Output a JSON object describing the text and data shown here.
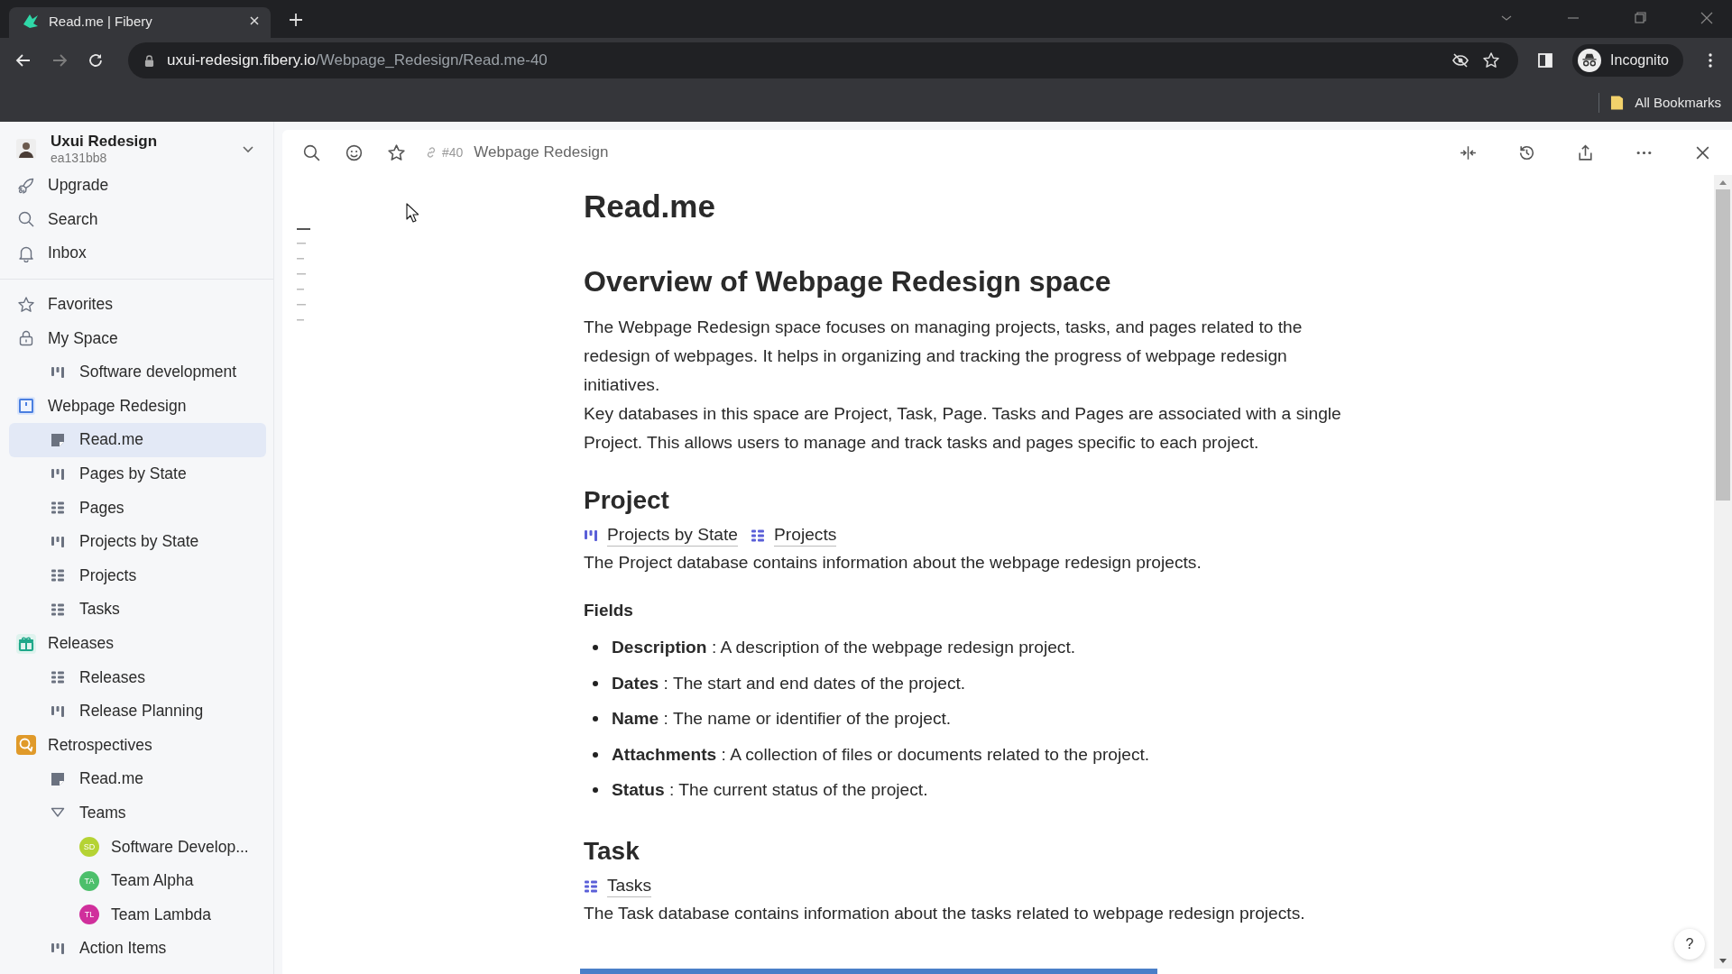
{
  "browser": {
    "tab": {
      "title": "Read.me | Fibery",
      "selected": true
    },
    "url": {
      "host": "uxui-redesign.fibery.io",
      "path": "/Webpage_Redesign/Read.me-40"
    },
    "profile": "Incognito",
    "bookmarks": "All Bookmarks"
  },
  "sidebar": {
    "workspace": {
      "name": "Uxui Redesign",
      "id": "ea131bb8"
    },
    "nav": [
      {
        "label": "Upgrade"
      },
      {
        "label": "Search"
      },
      {
        "label": "Inbox"
      }
    ],
    "tree": [
      {
        "label": "Favorites",
        "kind": "favorites",
        "selected": false
      },
      {
        "label": "My Space",
        "kind": "private",
        "selected": false,
        "children": [
          {
            "label": "Software development",
            "kind": "board",
            "selected": false
          }
        ]
      },
      {
        "label": "Webpage Redesign",
        "kind": "space",
        "color": "#4a7fe0",
        "selected": false,
        "children": [
          {
            "label": "Read.me",
            "kind": "doc",
            "selected": true
          },
          {
            "label": "Pages by State",
            "kind": "board",
            "selected": false
          },
          {
            "label": "Pages",
            "kind": "table",
            "selected": false
          },
          {
            "label": "Projects by State",
            "kind": "board",
            "selected": false
          },
          {
            "label": "Projects",
            "kind": "table",
            "selected": false
          },
          {
            "label": "Tasks",
            "kind": "table",
            "selected": false
          }
        ]
      },
      {
        "label": "Releases",
        "kind": "release-space",
        "color": "#1fa88a",
        "selected": false,
        "children": [
          {
            "label": "Releases",
            "kind": "table",
            "selected": false
          },
          {
            "label": "Release Planning",
            "kind": "board",
            "selected": false
          }
        ]
      },
      {
        "label": "Retrospectives",
        "kind": "retro-space",
        "color": "#e09a2a",
        "selected": false,
        "children": [
          {
            "label": "Read.me",
            "kind": "doc",
            "selected": false
          },
          {
            "label": "Teams",
            "kind": "folder",
            "selected": false,
            "expanded": true,
            "children": [
              {
                "label": "Software Develop...",
                "kind": "team",
                "initials": "SD",
                "color": "#b5d334",
                "selected": false
              },
              {
                "label": "Team Alpha",
                "kind": "team",
                "initials": "TA",
                "color": "#4cbf6b",
                "selected": false
              },
              {
                "label": "Team Lambda",
                "kind": "team",
                "initials": "TL",
                "color": "#d02f9c",
                "selected": false
              }
            ]
          },
          {
            "label": "Action Items",
            "kind": "board",
            "selected": false
          }
        ]
      }
    ]
  },
  "header": {
    "number": "#40",
    "breadcrumb": "Webpage Redesign"
  },
  "document": {
    "blocks": [
      {
        "kind": "title",
        "text": "Read.me"
      },
      {
        "kind": "h2",
        "text": "Overview of Webpage Redesign space"
      },
      {
        "kind": "p",
        "text": "The Webpage Redesign space focuses on managing projects, tasks, and pages related to the redesign of webpages. It helps in organizing and tracking the progress of webpage redesign initiatives."
      },
      {
        "kind": "p",
        "text": "Key databases in this space are Project, Task, Page. Tasks and Pages are associated with a single Project. This allows users to manage and track tasks and pages specific to each project."
      },
      {
        "kind": "h3",
        "text": "Project"
      },
      {
        "kind": "links",
        "links": [
          {
            "label": "Projects by State",
            "kind": "board"
          },
          {
            "label": "Projects",
            "kind": "table"
          }
        ]
      },
      {
        "kind": "p",
        "text": "The Project database contains information about the webpage redesign projects."
      },
      {
        "kind": "label",
        "text": "Fields"
      },
      {
        "kind": "bullets",
        "items": [
          "**Description** : A description of the webpage redesign project.",
          "**Dates** : The start and end dates of the project.",
          "**Name** : The name or identifier of the project.",
          "**Attachments** : A collection of files or documents related to the project.",
          "**Status** : The current status of the project."
        ]
      },
      {
        "kind": "h3",
        "text": "Task"
      },
      {
        "kind": "links",
        "links": [
          {
            "label": "Tasks",
            "kind": "table"
          }
        ]
      },
      {
        "kind": "p",
        "text": "The Task database contains information about the tasks related to webpage redesign projects."
      }
    ]
  },
  "help": "?"
}
